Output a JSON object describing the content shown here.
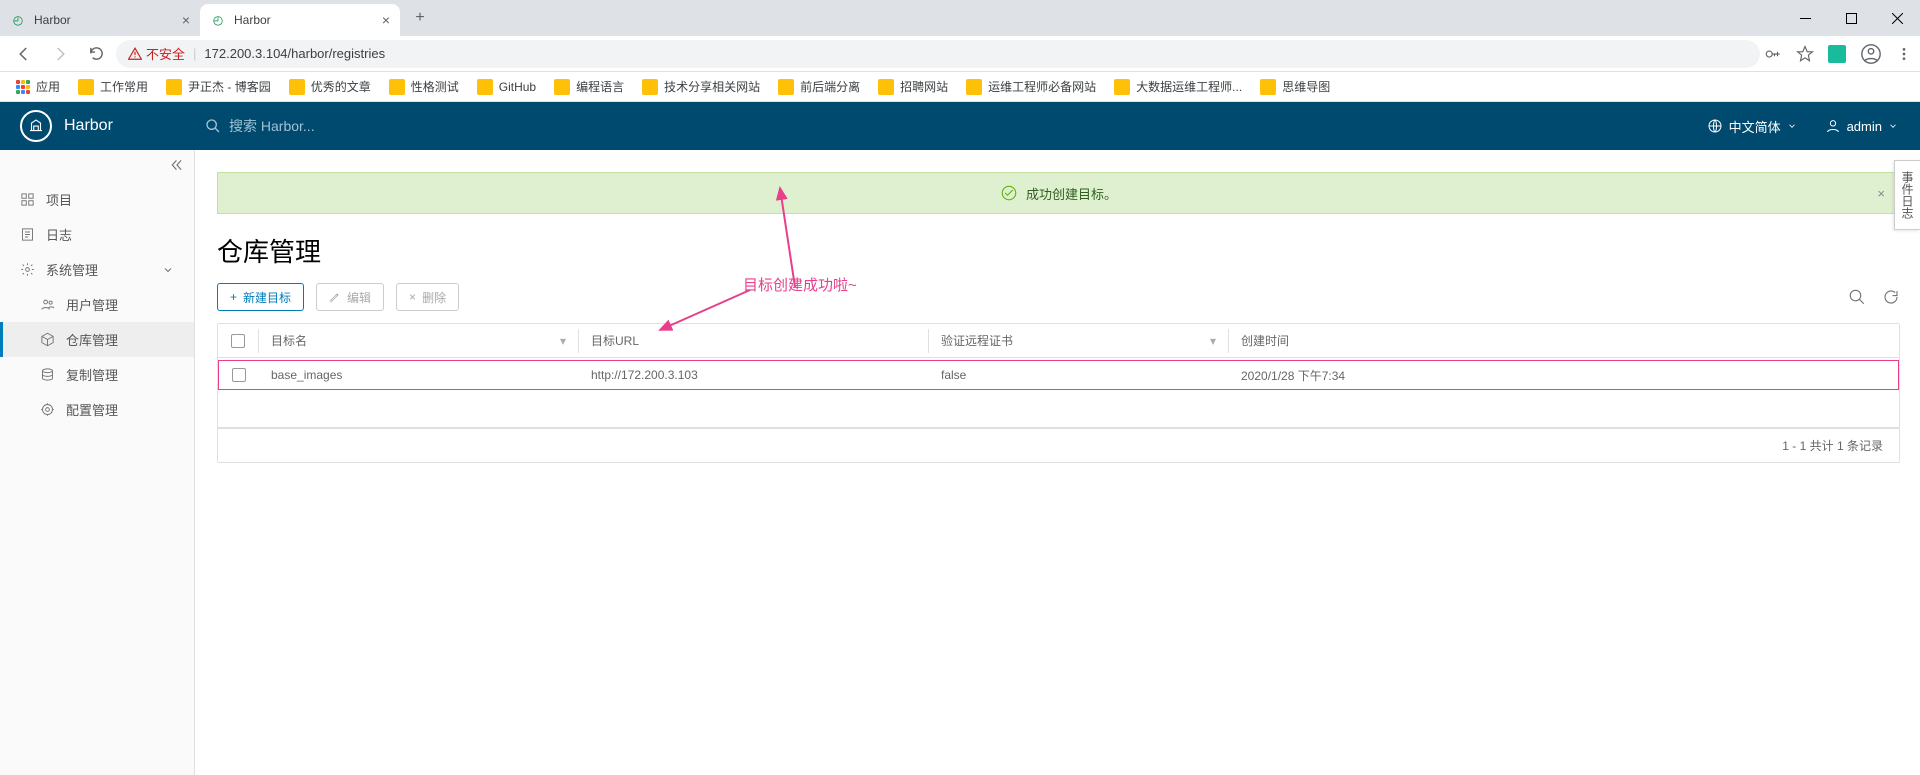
{
  "browser": {
    "tabs": [
      {
        "title": "Harbor"
      },
      {
        "title": "Harbor"
      }
    ],
    "insecure_label": "不安全",
    "url": "172.200.3.104/harbor/registries"
  },
  "bookmarks": {
    "apps": "应用",
    "items": [
      "工作常用",
      "尹正杰 - 博客园",
      "优秀的文章",
      "性格测试",
      "GitHub",
      "编程语言",
      "技术分享相关网站",
      "前后端分离",
      "招聘网站",
      "运维工程师必备网站",
      "大数据运维工程师...",
      "思维导图"
    ]
  },
  "header": {
    "app_name": "Harbor",
    "search_placeholder": "搜索 Harbor...",
    "lang_label": "中文简体",
    "user_label": "admin"
  },
  "sidebar": {
    "items": [
      {
        "label": "项目",
        "icon": "projects"
      },
      {
        "label": "日志",
        "icon": "logs"
      },
      {
        "label": "系统管理",
        "icon": "admin",
        "expanded": true
      },
      {
        "label": "用户管理",
        "icon": "users",
        "sub": true
      },
      {
        "label": "仓库管理",
        "icon": "registry",
        "sub": true,
        "active": true
      },
      {
        "label": "复制管理",
        "icon": "replication",
        "sub": true
      },
      {
        "label": "配置管理",
        "icon": "config",
        "sub": true
      }
    ]
  },
  "alert": {
    "text": "成功创建目标。"
  },
  "page": {
    "title": "仓库管理"
  },
  "toolbar": {
    "new_label": "新建目标",
    "edit_label": "编辑",
    "delete_label": "删除"
  },
  "table": {
    "columns": {
      "name": "目标名",
      "url": "目标URL",
      "cert": "验证远程证书",
      "time": "创建时间"
    },
    "rows": [
      {
        "name": "base_images",
        "url": "http://172.200.3.103",
        "cert": "false",
        "time": "2020/1/28 下午7:34"
      }
    ],
    "footer": "1 - 1 共计 1 条记录"
  },
  "annotation": {
    "text": "目标创建成功啦~"
  },
  "event_log": {
    "label": "事件日志"
  }
}
